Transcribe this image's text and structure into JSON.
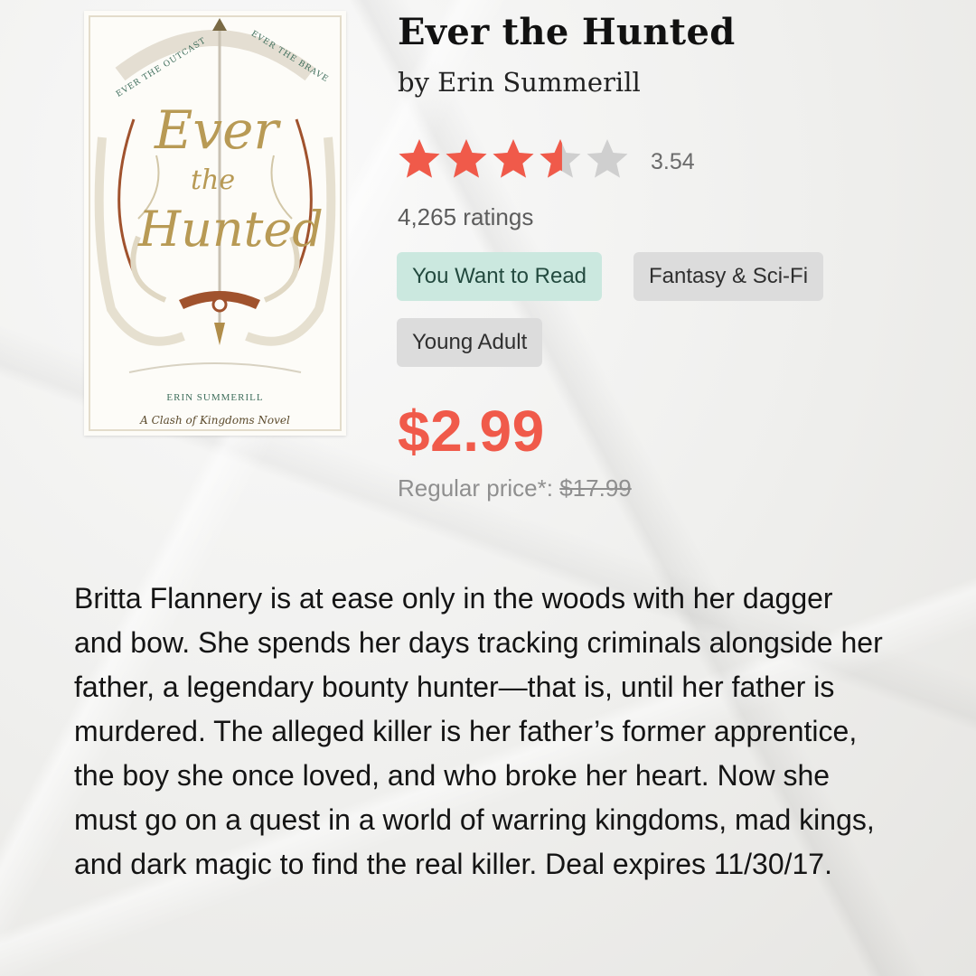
{
  "book": {
    "title": "Ever the Hunted",
    "author": "by Erin Summerill",
    "rating_value": "3.54",
    "rating_stars": 3.54,
    "rating_max": 5,
    "ratings_count": "4,265 ratings"
  },
  "cover": {
    "banner_left": "EVER THE OUTCAST",
    "banner_right": "EVER THE BRAVE",
    "word_ever": "Ever",
    "word_the": "the",
    "word_hunted": "Hunted",
    "author": "ERIN SUMMERILL",
    "series": "A Clash of Kingdoms Novel"
  },
  "tags": {
    "want_to_read": "You Want to Read",
    "genre_1": "Fantasy & Sci-Fi",
    "genre_2": "Young Adult"
  },
  "pricing": {
    "sale_price": "$2.99",
    "regular_label": "Regular price*:",
    "regular_price": "$17.99"
  },
  "description": "Britta Flannery is at ease only in the woods with her dagger and bow. She spends her days tracking criminals alongside her father, a legendary bounty hunter—that is, until her father is murdered. The alleged killer is her father’s former apprentice, the boy she once loved, and who broke her heart. Now she must go on a quest in a world of warring kingdoms, mad kings, and dark magic to find the real killer. Deal expires 11/30/17.",
  "colors": {
    "star_filled": "#f05a4a",
    "star_empty": "#cfcfcf",
    "price": "#f05a4a",
    "want_chip": "#cbe8df",
    "genre_chip": "#dcdcdc"
  },
  "icons": {
    "star": "star-icon"
  }
}
